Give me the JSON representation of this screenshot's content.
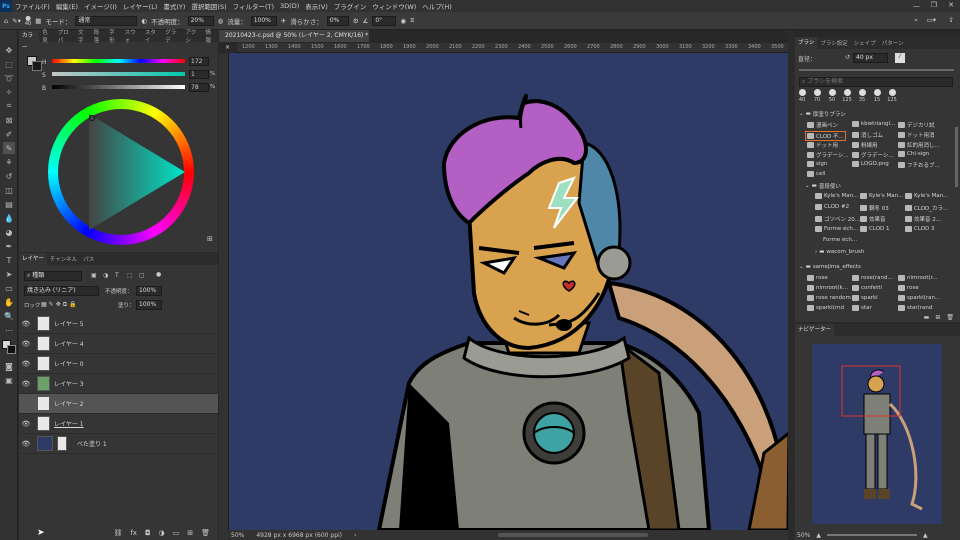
{
  "app": {
    "logo": "Ps"
  },
  "menu": [
    "ファイル(F)",
    "編集(E)",
    "イメージ(I)",
    "レイヤー(L)",
    "書式(Y)",
    "選択範囲(S)",
    "フィルター(T)",
    "3D(D)",
    "表示(V)",
    "プラグイン",
    "ウィンドウ(W)",
    "ヘルプ(H)"
  ],
  "options": {
    "brush_size": "40",
    "mode_label": "モード：",
    "mode_value": "通常",
    "opacity_label": "不透明度：",
    "opacity_value": "20%",
    "flow_label": "流量：",
    "flow_value": "100%",
    "smooth_label": "滑らかさ：",
    "smooth_value": "0%",
    "angle_value": "0°"
  },
  "color_tabs": [
    "カラー",
    "色見",
    "プロパ",
    "文字",
    "段落",
    "字形",
    "スウォ",
    "スタイ",
    "グラデ",
    "アクシ",
    "情報"
  ],
  "hsb": {
    "h_label": "H",
    "h_value": "172",
    "s_label": "S",
    "s_value": "1",
    "b_label": "B",
    "b_value": "78",
    "pct": "%"
  },
  "layers": {
    "tabs": [
      "レイヤー",
      "チャンネル",
      "パス"
    ],
    "kind": "種類",
    "blend": "焼き込み (リニア)",
    "opacity_label": "不透明度：",
    "opacity_value": "100%",
    "lock_label": "ロック：",
    "fill_label": "塗り：",
    "fill_value": "100%",
    "rows": [
      {
        "name": "レイヤー 5"
      },
      {
        "name": "レイヤー 4"
      },
      {
        "name": "レイヤー 0"
      },
      {
        "name": "レイヤー 3"
      },
      {
        "name": "レイヤー 2"
      },
      {
        "name": "レイヤー 1"
      },
      {
        "name": "べた塗り 1"
      }
    ]
  },
  "document": {
    "tab_title": "20210423-c.psd @ 50% (レイヤー 2, CMYK/16) *",
    "zoom": "50%",
    "info": "4928 px x 6968 px (600 ppi)"
  },
  "ruler": [
    "1200",
    "1300",
    "1400",
    "1500",
    "1600",
    "1700",
    "1800",
    "1900",
    "2000",
    "2100",
    "2200",
    "2300",
    "2400",
    "2500",
    "2600",
    "2700",
    "2800",
    "2900",
    "3000",
    "3100",
    "3200",
    "3300",
    "3400",
    "3500"
  ],
  "brush_panel": {
    "tabs": [
      "ブラシ",
      "ブラシ設定",
      "シェイプ",
      "パターン"
    ],
    "size_label": "直径：",
    "size_value": "40 px",
    "search_placeholder": "ブラシを検索",
    "sizes": [
      "40",
      "70",
      "50",
      "125",
      "35",
      "15",
      "125"
    ],
    "groups": [
      {
        "label": "厚塗りブラシ",
        "items": [
          "漫画ペン",
          "kbwtriangl...",
          "デジカリ試",
          "CLOD 不...",
          "消しゴム",
          "ドット用消",
          "ドット用",
          "粉線用",
          "紅的用消し...",
          "グラデーシ...",
          "グラデーシ...",
          "Chi-sign",
          "sign",
          "LOGO.png",
          "フチおるブ...",
          "cell"
        ]
      },
      {
        "label": "普段使い",
        "items": [
          "Kyle's Man...",
          "Kyle's Man...",
          "Kyle's Man...",
          "CLOD #2",
          "鋼冬 03",
          "CLOD_カラ...",
          "ゴツペン 20...",
          "効果音",
          "効果音 2...",
          "Forme éch...",
          "CLOD 1",
          "CLOD 3",
          "Forme éch...",
          "wacom_brush"
        ]
      },
      {
        "label": "samejima_effects",
        "items": [
          "rose",
          "rose(rand...",
          "nimroot(r...",
          "nimroot(k...",
          "confetti",
          "rose",
          "rose random",
          "sparkl",
          "sparkl(ran...",
          "sparkl(rnd",
          "star",
          "star(rand"
        ]
      }
    ]
  },
  "navigator": {
    "tab": "ナビゲーター",
    "zoom": "50%"
  },
  "colors": {
    "canvas": "#2e3b66",
    "hair": "#b45fc3",
    "skin": "#d9a24e",
    "suit": "#7e7f77",
    "accent": "#31a8ff"
  }
}
